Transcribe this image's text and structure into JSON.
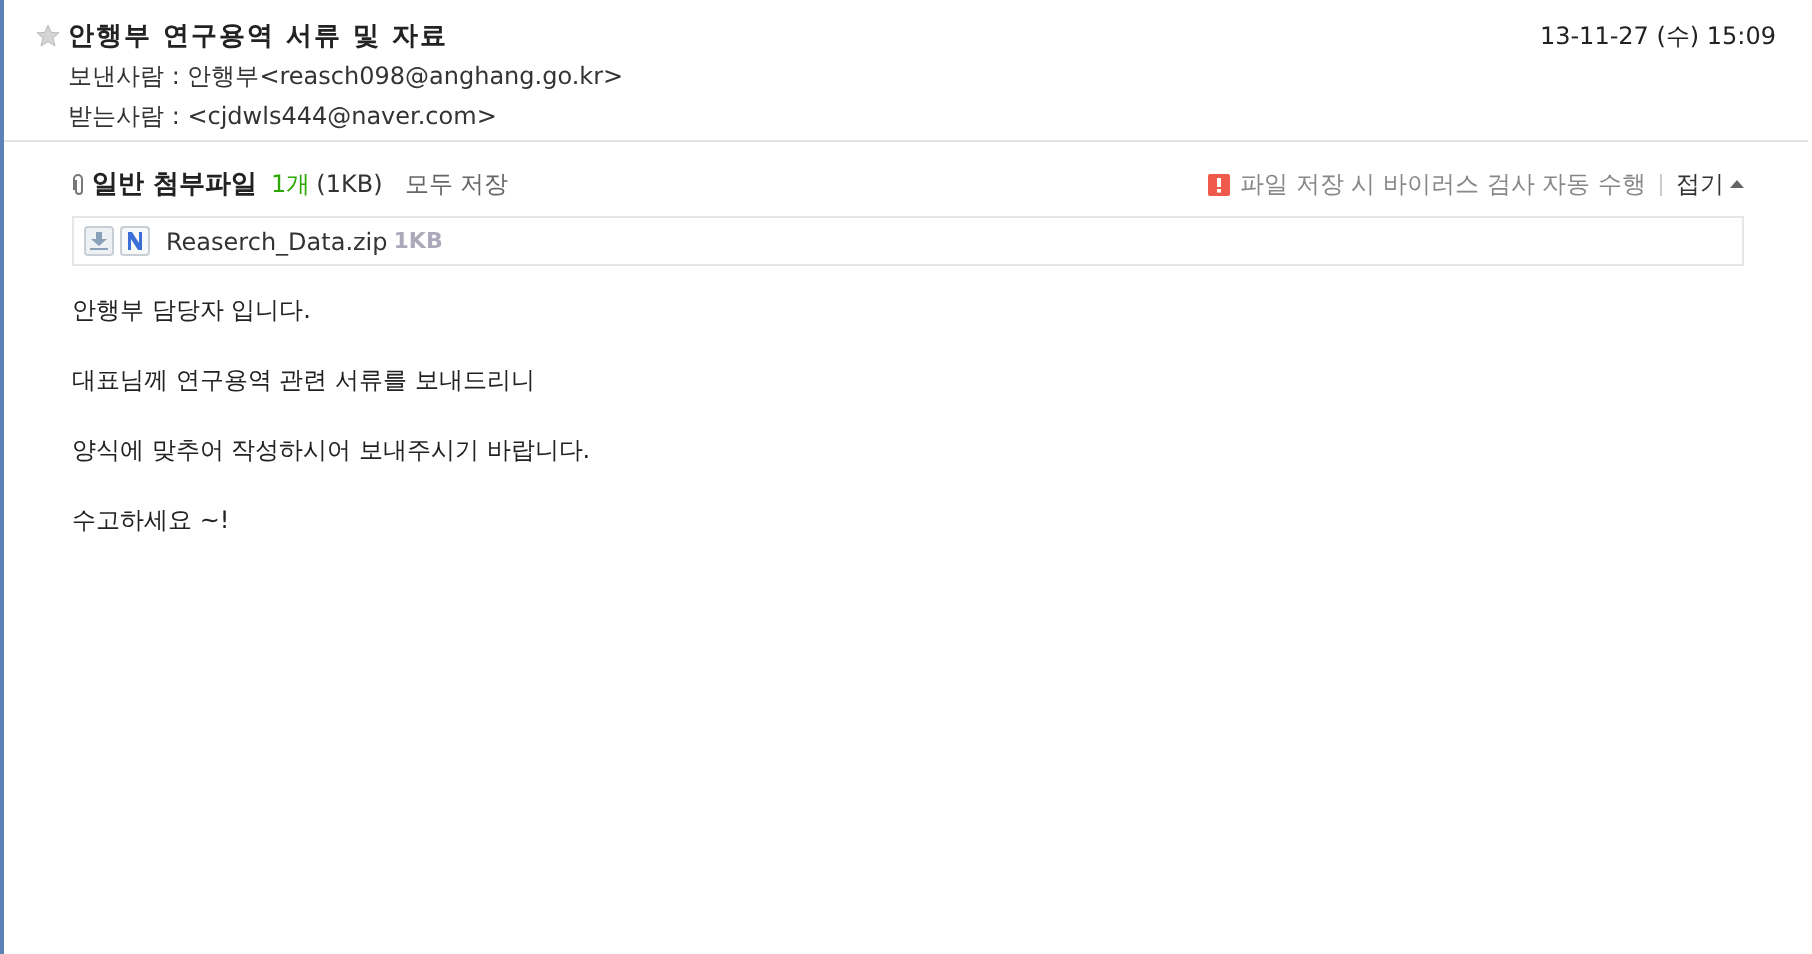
{
  "mail": {
    "subject": "안행부 연구용역 서류 및 자료",
    "starred": false,
    "date": "13-11-27 (수) 15:09",
    "from_label": "보낸사람 :",
    "from": "안행부<reasch098@anghang.go.kr>",
    "to_label": "받는사람 :",
    "to": "<cjdwls444@naver.com>"
  },
  "attachments": {
    "title": "일반 첨부파일",
    "count": "1개",
    "size": "(1KB)",
    "save_all": "모두 저장",
    "notice": "파일 저장 시 바이러스 검사 자동 수행",
    "collapse": "접기",
    "files": [
      {
        "name": "Reaserch_Data.zip",
        "size": "1KB"
      }
    ]
  },
  "body": [
    "안행부 담당자 입니다.",
    "대표님께 연구용역 관련 서류를 보내드리니",
    "양식에 맞추어 작성하시어 보내주시기 바랍니다.",
    "수고하세요 ~!"
  ]
}
